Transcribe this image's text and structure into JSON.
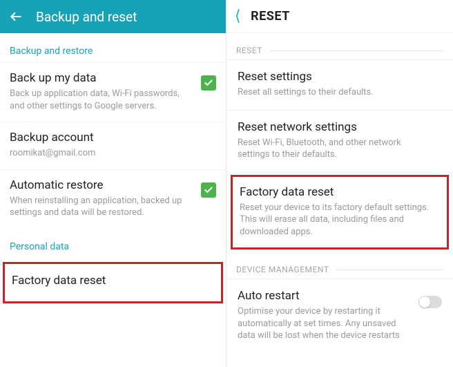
{
  "left": {
    "header_title": "Backup and reset",
    "section_backup": "Backup and restore",
    "backup_my_data": {
      "title": "Back up my data",
      "sub": "Back up application data, Wi-Fi passwords, and other settings to Google servers."
    },
    "backup_account": {
      "title": "Backup account",
      "sub": "roomikat@gmail.com"
    },
    "automatic_restore": {
      "title": "Automatic restore",
      "sub": "When reinstalling an application, backed up settings and data will be restored."
    },
    "section_personal": "Personal data",
    "factory_reset": {
      "title": "Factory data reset"
    }
  },
  "right": {
    "header_title": "RESET",
    "section_reset": "RESET",
    "reset_settings": {
      "title": "Reset settings",
      "sub": "Reset all settings to their defaults."
    },
    "reset_network": {
      "title": "Reset network settings",
      "sub": "Reset Wi-Fi, Bluetooth, and other network settings to their defaults."
    },
    "factory_reset": {
      "title": "Factory data reset",
      "sub": "Reset your device to its factory default settings. This will erase all data, including files and downloaded apps."
    },
    "section_device": "DEVICE MANAGEMENT",
    "auto_restart": {
      "title": "Auto restart",
      "sub": "Optimise your device by restarting it automatically at set times. Any unsaved data will be lost when the device restarts"
    }
  }
}
